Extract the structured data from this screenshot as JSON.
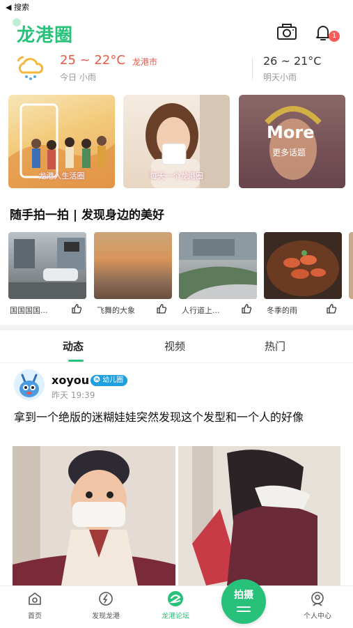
{
  "status_bar": {
    "back_label": "◀ 搜索"
  },
  "header": {
    "app_name": "龙港圈",
    "notification_count": "1"
  },
  "weather": {
    "today_temp": "25 ~ 22°C",
    "city": "龙港市",
    "today_desc": "今日 小雨",
    "tomorrow_temp": "26 ~ 21°C",
    "tomorrow_desc": "明天小雨"
  },
  "topics": [
    {
      "caption": "龙港人生活圈"
    },
    {
      "caption": "每天一个龙港圈"
    },
    {
      "title": "More",
      "caption": "更多话题"
    }
  ],
  "photo_section": {
    "title": "随手拍一拍 | 发现身边的美好",
    "items": [
      {
        "caption": "国国国国..."
      },
      {
        "caption": "飞舞的大象"
      },
      {
        "caption": "人行道上..."
      },
      {
        "caption": "冬季的雨"
      }
    ]
  },
  "feed_tabs": [
    {
      "label": "动态",
      "active": true
    },
    {
      "label": "视频",
      "active": false
    },
    {
      "label": "热门",
      "active": false
    }
  ],
  "post": {
    "username": "xoyou",
    "tag": "幼儿圈",
    "time": "昨天 19:39",
    "text": "拿到一个绝版的迷糊娃娃突然发现这个发型和一个人的好像"
  },
  "tab_bar": {
    "items": [
      {
        "label": "首页",
        "icon": "home-icon"
      },
      {
        "label": "发现龙港",
        "icon": "discover-icon"
      },
      {
        "label": "龙港论坛",
        "icon": "forum-icon",
        "active": true
      },
      {
        "label": "个人中心",
        "icon": "profile-icon"
      }
    ],
    "shoot_label": "拍摄"
  },
  "colors": {
    "accent": "#27c17a",
    "temp": "#e55a47",
    "badge": "#ff5a5a",
    "tag": "#1e9fe0"
  }
}
